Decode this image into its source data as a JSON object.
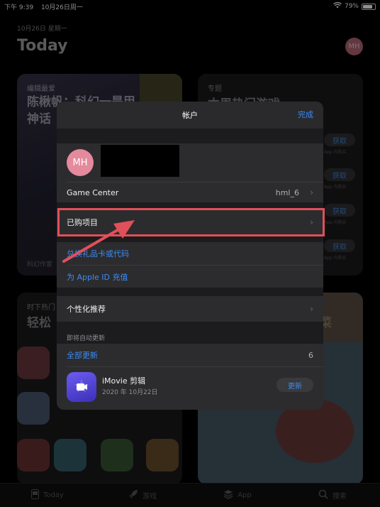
{
  "status_bar": {
    "time": "下午 9:39",
    "date": "10月26日周一",
    "battery": "79%",
    "battery_level": 0.79
  },
  "today": {
    "date": "10月26日 星期一",
    "title": "Today",
    "avatar": "MH"
  },
  "background_cards": {
    "card1": {
      "subtitle": "编辑最爱",
      "title": "陈楸帆：科幻一是甲\n神话",
      "footer": "科幻作家"
    },
    "card2": {
      "subtitle": "专题",
      "title": "本周热门游戏",
      "get_label": "获取",
      "get_note": "App 内购买"
    },
    "card3": {
      "subtitle": "时下热门",
      "title": "轻松"
    },
    "card4": {
      "title": "菜"
    }
  },
  "tab_bar": {
    "items": [
      {
        "label": "Today",
        "icon": "today-icon"
      },
      {
        "label": "游戏",
        "icon": "games-rocket-icon"
      },
      {
        "label": "App",
        "icon": "apps-stack-icon"
      },
      {
        "label": "搜索",
        "icon": "search-icon"
      }
    ]
  },
  "sheet": {
    "title": "帐户",
    "done_label": "完成",
    "profile": {
      "initials": "MH"
    },
    "game_center": {
      "label": "Game Center",
      "value": "hml_6"
    },
    "purchased": {
      "label": "已购项目"
    },
    "redeem": {
      "label": "兑换礼品卡或代码"
    },
    "add_funds": {
      "label": "为 Apple ID 充值"
    },
    "personalized": {
      "label": "个性化推荐"
    },
    "pending_updates": {
      "header": "即将自动更新",
      "update_all_label": "全部更新",
      "count": "6",
      "apps": [
        {
          "name": "iMovie 剪辑",
          "date": "2020 年 10月22日",
          "button": "更新",
          "icon": "imovie-icon"
        }
      ]
    }
  },
  "colors": {
    "accent_blue": "#3b8cf7",
    "highlight_red": "#e0505a",
    "sheet_bg": "#1c1c1e",
    "row_bg": "#2c2c2e"
  }
}
